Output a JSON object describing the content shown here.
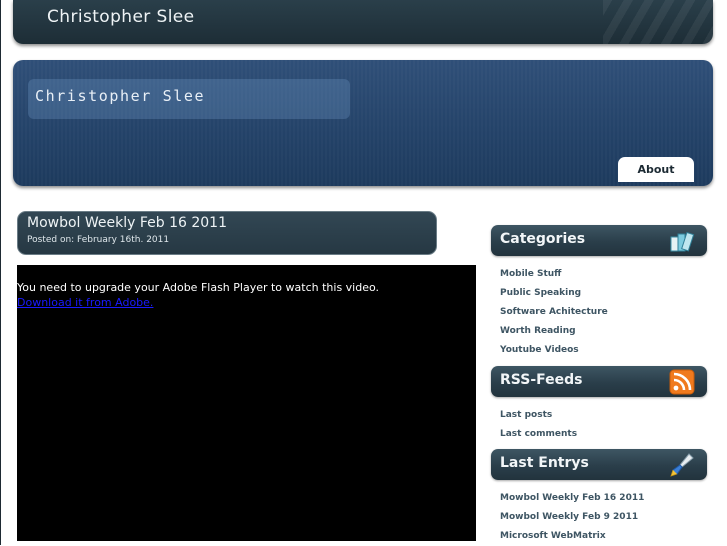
{
  "topbar": {
    "title": "Christopher Slee"
  },
  "banner": {
    "name": "Christopher Slee",
    "nav": [
      {
        "label": "About"
      }
    ]
  },
  "post": {
    "title": "Mowbol Weekly Feb 16 2011",
    "date": "Posted on: February 16th. 2011",
    "video": {
      "message": "You need to upgrade your Adobe Flash Player to watch this video.",
      "link": "Download it from Adobe."
    }
  },
  "sidebar": {
    "categories": {
      "heading": "Categories",
      "icon": "books-icon",
      "items": [
        "Mobile Stuff",
        "Public Speaking",
        "Software Achitecture",
        "Worth Reading",
        "Youtube Videos"
      ]
    },
    "rss": {
      "heading": "RSS-Feeds",
      "icon": "rss-icon",
      "items": [
        "Last posts",
        "Last comments"
      ]
    },
    "last_entries": {
      "heading": "Last Entrys",
      "icon": "brush-icon",
      "items": [
        "Mowbol Weekly Feb 16 2011",
        "Mowbol Weekly Feb 9 2011",
        "Microsoft WebMatrix"
      ]
    }
  },
  "colors": {
    "accent": "#2b4a72",
    "panel": "#2a3e4a",
    "link": "#3e5563",
    "rss": "#f07a1e"
  }
}
